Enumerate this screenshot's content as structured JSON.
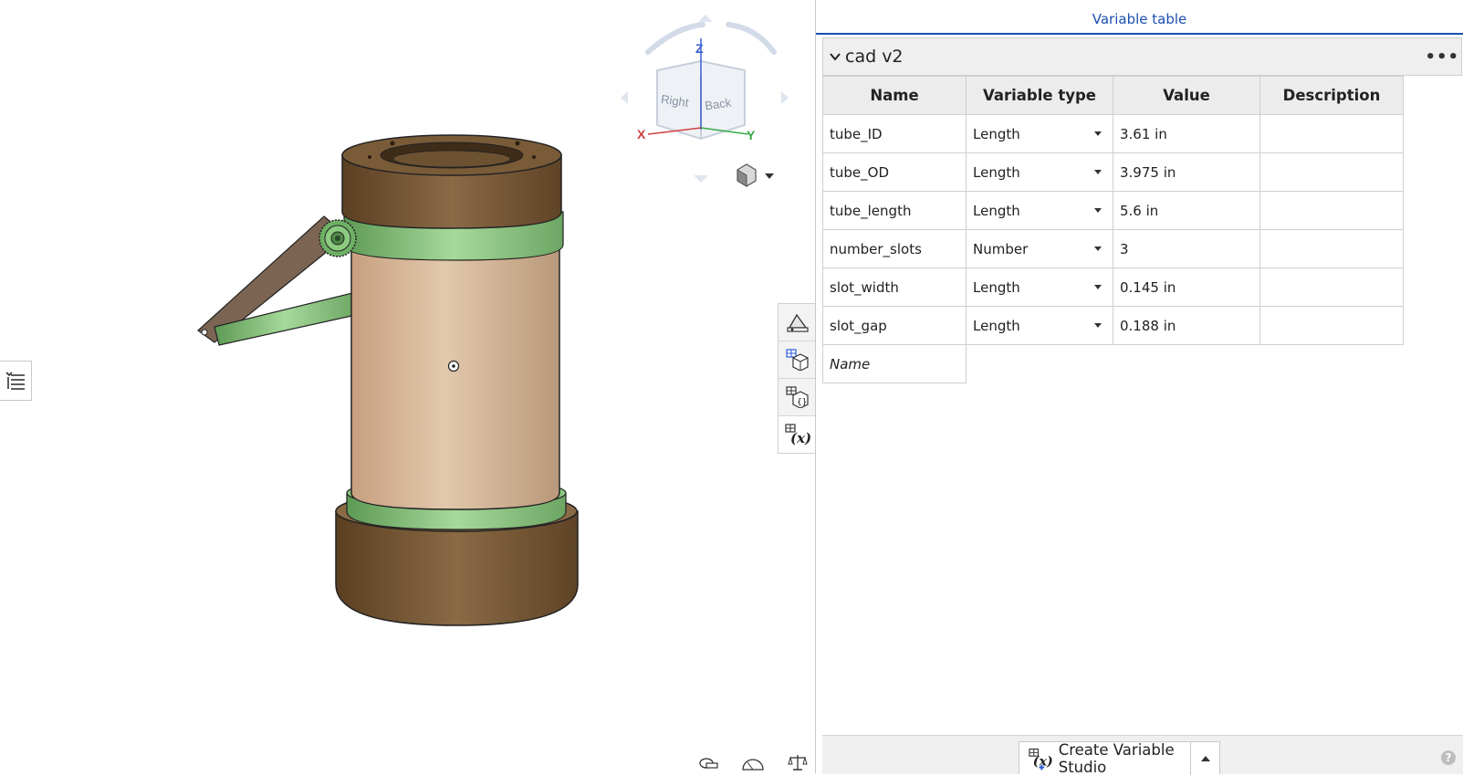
{
  "viewport": {
    "viewcube": {
      "axis_z": "Z",
      "axis_x": "X",
      "axis_y": "Y",
      "face_right": "Right",
      "face_back": "Back"
    },
    "icons": [
      "list-icon",
      "viewcube-icon",
      "appearance-icon",
      "configurations-icon",
      "variable-icon",
      "measure-icon",
      "protractor-icon",
      "mass-properties-icon"
    ]
  },
  "panel": {
    "title": "Variable table",
    "section": {
      "title": "cad v2",
      "more": "•••"
    },
    "columns": [
      "Name",
      "Variable type",
      "Value",
      "Description"
    ],
    "rows": [
      {
        "name": "tube_ID",
        "type": "Length",
        "value": "3.61 in",
        "description": ""
      },
      {
        "name": "tube_OD",
        "type": "Length",
        "value": "3.975 in",
        "description": ""
      },
      {
        "name": "tube_length",
        "type": "Length",
        "value": "5.6 in",
        "description": ""
      },
      {
        "name": "number_slots",
        "type": "Number",
        "value": "3",
        "description": ""
      },
      {
        "name": "slot_width",
        "type": "Length",
        "value": "0.145 in",
        "description": ""
      },
      {
        "name": "slot_gap",
        "type": "Length",
        "value": "0.188 in",
        "description": ""
      }
    ],
    "new_row_placeholder": "Name",
    "footer": {
      "create_label": "Create Variable Studio",
      "help": "?"
    }
  },
  "colors": {
    "accent": "#1b4fb2",
    "bronze": "#6e5230",
    "green": "#7fbf73",
    "tube": "#c8a98b"
  }
}
